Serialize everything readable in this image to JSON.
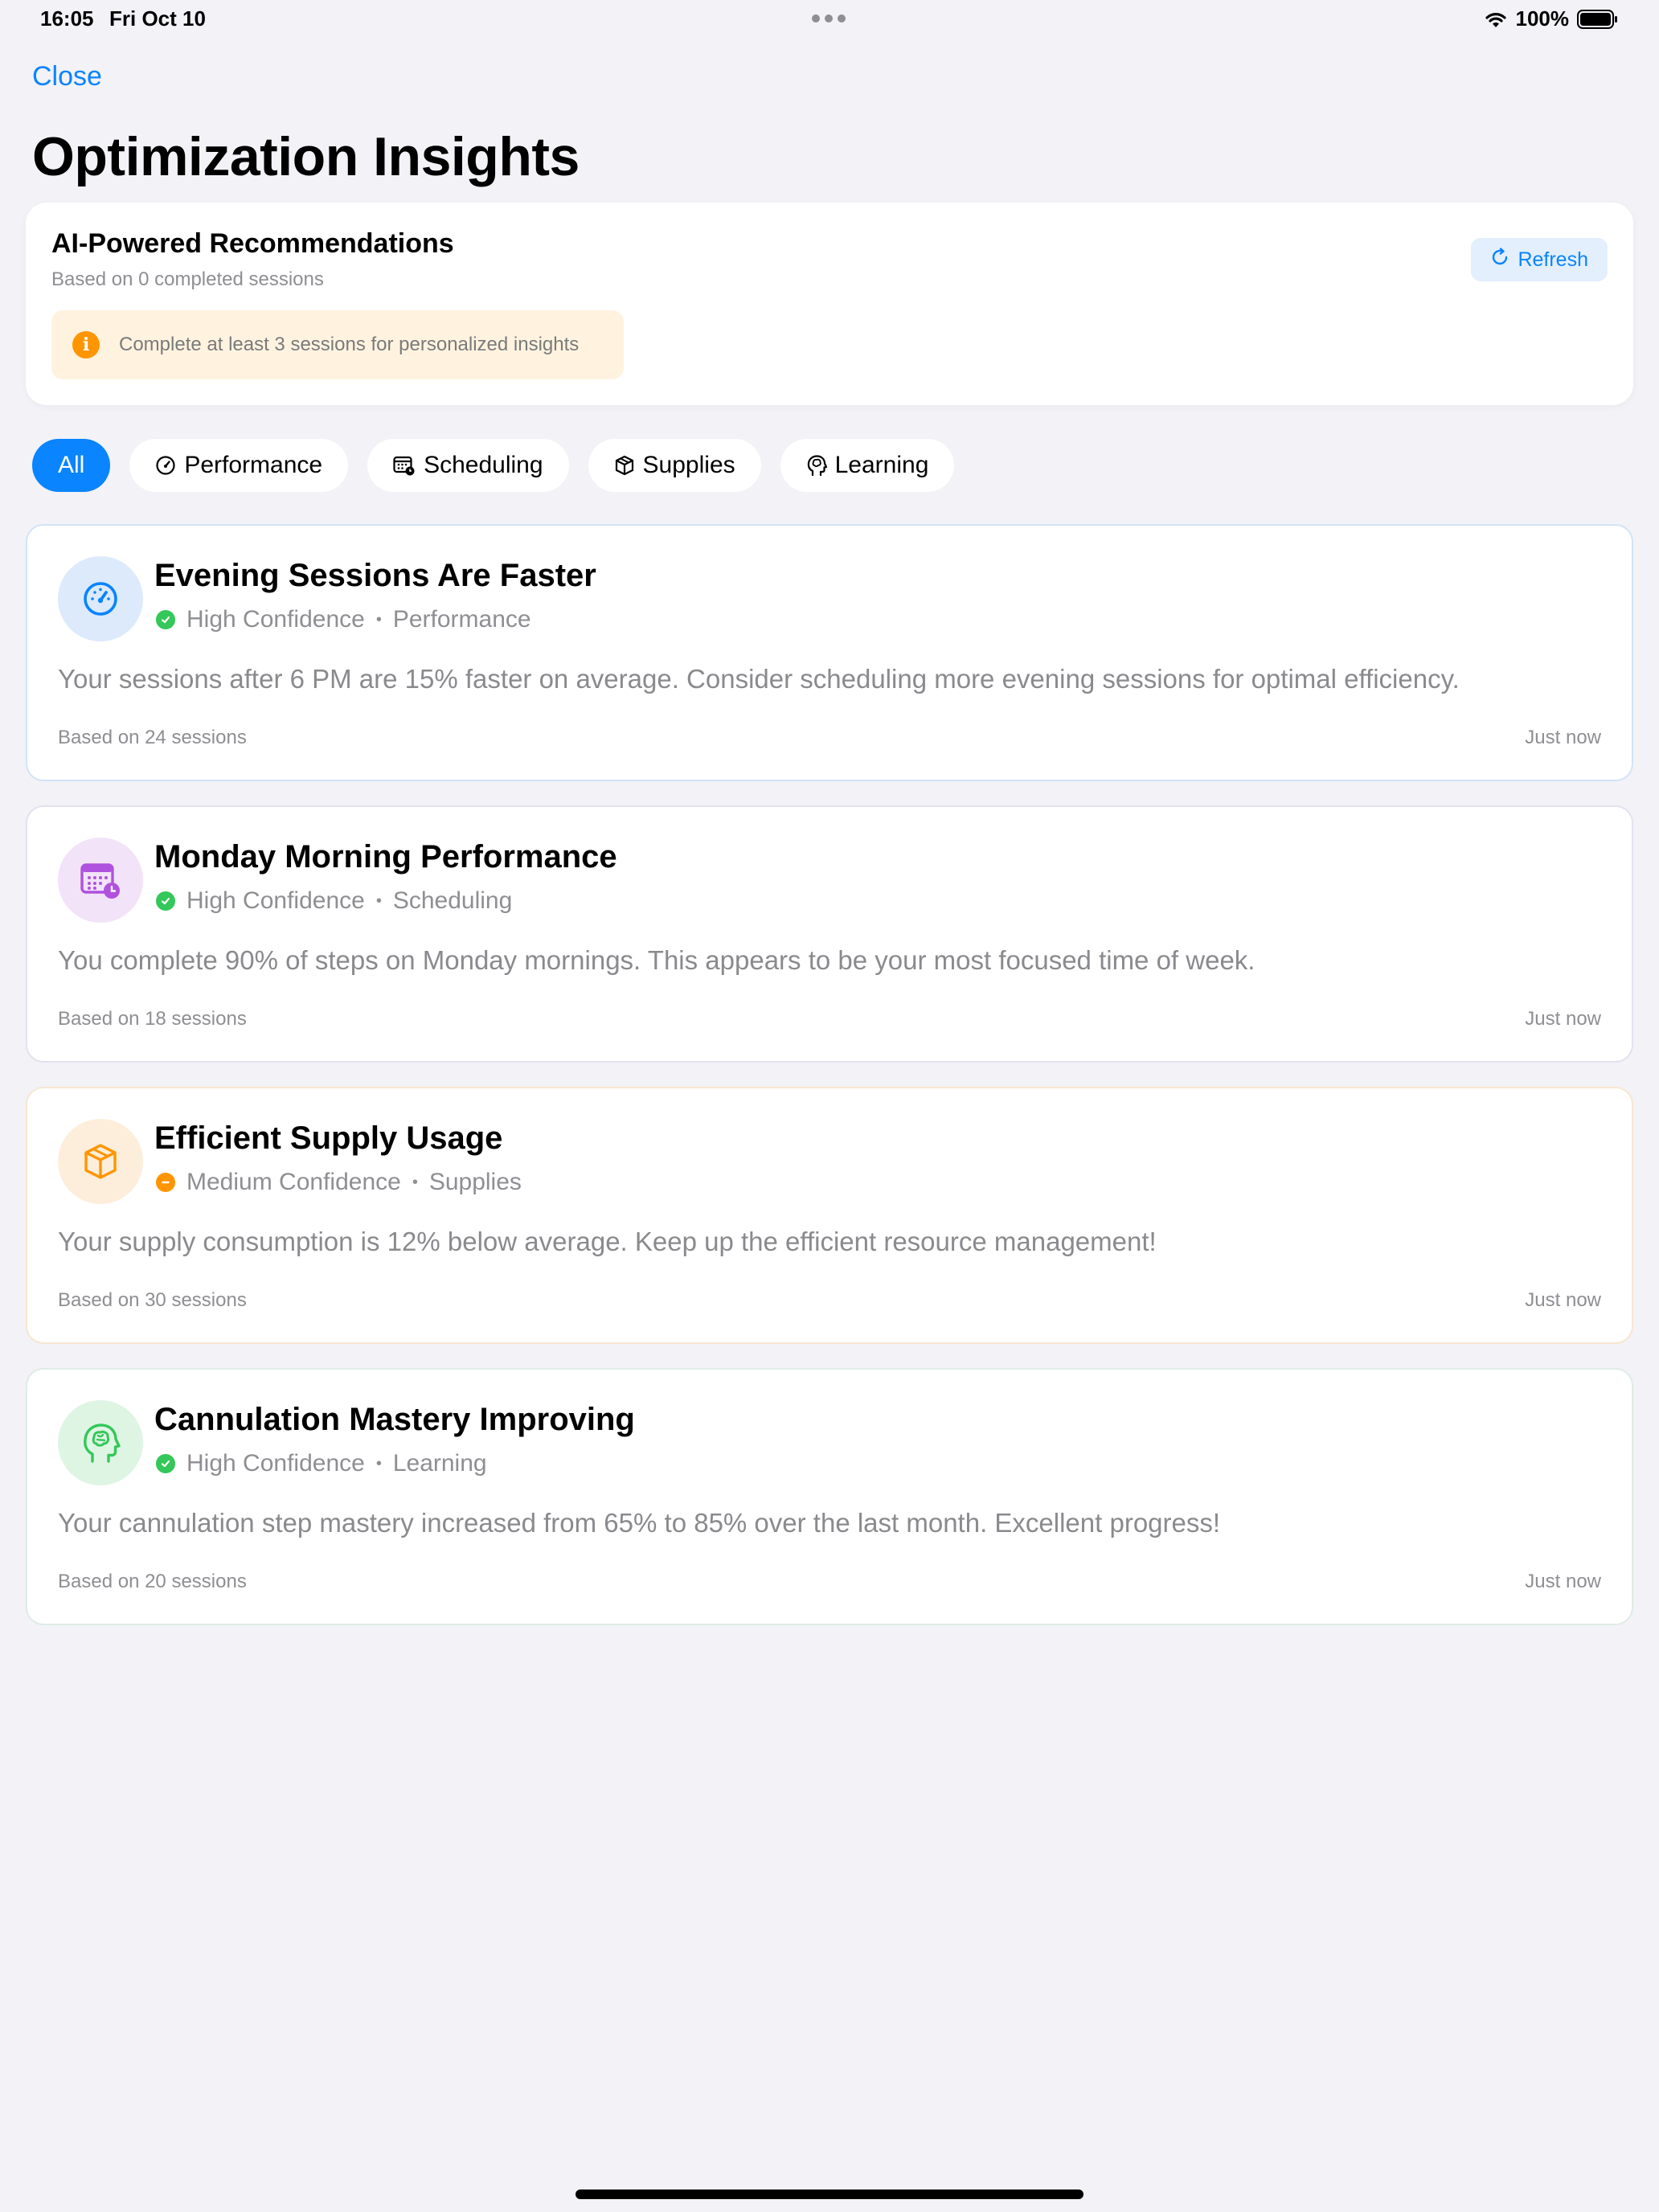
{
  "status_bar": {
    "time": "16:05",
    "date": "Fri Oct 10",
    "battery": "100%"
  },
  "nav": {
    "close_label": "Close",
    "title": "Optimization Insights"
  },
  "summary": {
    "title": "AI-Powered Recommendations",
    "subtitle": "Based on 0 completed sessions",
    "refresh_label": "Refresh",
    "notice": "Complete at least 3 sessions for personalized insights"
  },
  "filters": [
    {
      "label": "All",
      "icon": "none",
      "active": true
    },
    {
      "label": "Performance",
      "icon": "gauge-icon",
      "active": false
    },
    {
      "label": "Scheduling",
      "icon": "calendar-clock-icon",
      "active": false
    },
    {
      "label": "Supplies",
      "icon": "box-icon",
      "active": false
    },
    {
      "label": "Learning",
      "icon": "brain-head-icon",
      "active": false
    }
  ],
  "insights": [
    {
      "title": "Evening Sessions Are Faster",
      "confidence": "High Confidence",
      "category": "Performance",
      "body": "Your sessions after 6 PM are 15% faster on average. Consider scheduling more evening sessions for optimal efficiency.",
      "based_on": "Based on 24 sessions",
      "time": "Just now",
      "icon": "gauge-icon",
      "accent": "#0a84ff"
    },
    {
      "title": "Monday Morning Performance",
      "confidence": "High Confidence",
      "category": "Scheduling",
      "body": "You complete 90% of steps on Monday mornings. This appears to be your most focused time of week.",
      "based_on": "Based on 18 sessions",
      "time": "Just now",
      "icon": "calendar-clock-icon",
      "accent": "#af52de"
    },
    {
      "title": "Efficient Supply Usage",
      "confidence": "Medium Confidence",
      "category": "Supplies",
      "body": "Your supply consumption is 12% below average. Keep up the efficient resource management!",
      "based_on": "Based on 30 sessions",
      "time": "Just now",
      "icon": "box-icon",
      "accent": "#ff9500"
    },
    {
      "title": "Cannulation Mastery Improving",
      "confidence": "High Confidence",
      "category": "Learning",
      "body": "Your cannulation step mastery increased from 65% to 85% over the last month. Excellent progress!",
      "based_on": "Based on 20 sessions",
      "time": "Just now",
      "icon": "brain-head-icon",
      "accent": "#34c759"
    }
  ],
  "colors": {
    "accent_blue": "#0a84ff",
    "high_confidence": "#34c759",
    "medium_confidence": "#ff9500",
    "background": "#f2f2f7"
  }
}
